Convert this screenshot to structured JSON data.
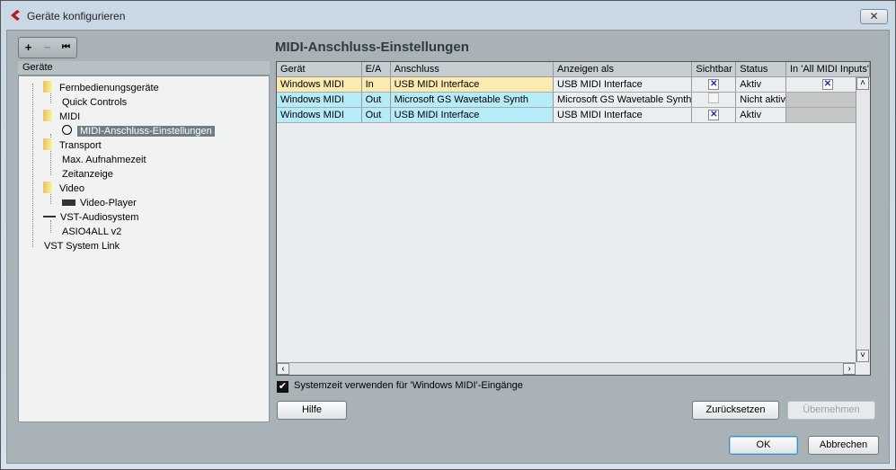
{
  "window": {
    "title": "Geräte konfigurieren",
    "close_label": "✕"
  },
  "toolbar": {
    "add": "+",
    "remove": "−",
    "reset": "⏮"
  },
  "tree": {
    "header": "Geräte",
    "items": [
      {
        "label": "Fernbedienungsgeräte",
        "icon": "folder-icon"
      },
      {
        "label": "Quick Controls"
      },
      {
        "label": "MIDI",
        "icon": "folder-icon"
      },
      {
        "label": "MIDI-Anschluss-Einstellungen",
        "icon": "midi-port-icon",
        "selected": true
      },
      {
        "label": "Transport",
        "icon": "folder-icon"
      },
      {
        "label": "Max. Aufnahmezeit"
      },
      {
        "label": "Zeitanzeige"
      },
      {
        "label": "Video",
        "icon": "folder-icon"
      },
      {
        "label": "Video-Player",
        "icon": "video-icon"
      },
      {
        "label": "VST-Audiosystem",
        "icon": "audio-icon"
      },
      {
        "label": "ASIO4ALL v2"
      },
      {
        "label": "VST System Link"
      }
    ]
  },
  "panel": {
    "title": "MIDI-Anschluss-Einstellungen",
    "columns": [
      "Gerät",
      "E/A",
      "Anschluss",
      "Anzeigen als",
      "Sichtbar",
      "Status",
      "In 'All MIDI Inputs'"
    ],
    "rows": [
      {
        "device": "Windows MIDI",
        "io": "In",
        "port": "USB MIDI Interface",
        "show_as": "USB MIDI Interface",
        "visible": true,
        "status": "Aktiv",
        "all_midi": true
      },
      {
        "device": "Windows MIDI",
        "io": "Out",
        "port": "Microsoft GS Wavetable Synth",
        "show_as": "Microsoft GS Wavetable Synth",
        "visible": false,
        "status": "Nicht aktiv"
      },
      {
        "device": "Windows MIDI",
        "io": "Out",
        "port": "USB MIDI Interface",
        "show_as": "USB MIDI Interface",
        "visible": true,
        "status": "Aktiv"
      }
    ],
    "systemtime_label": "Systemzeit verwenden für 'Windows MIDI'-Eingänge",
    "systemtime_checked": true,
    "help": "Hilfe",
    "reset": "Zurücksetzen",
    "apply": "Übernehmen"
  },
  "footer": {
    "ok": "OK",
    "cancel": "Abbrechen"
  },
  "colors": {
    "input_row": "#fcebb1",
    "output_row": "#b6ecf8",
    "selection": "#707e84"
  }
}
